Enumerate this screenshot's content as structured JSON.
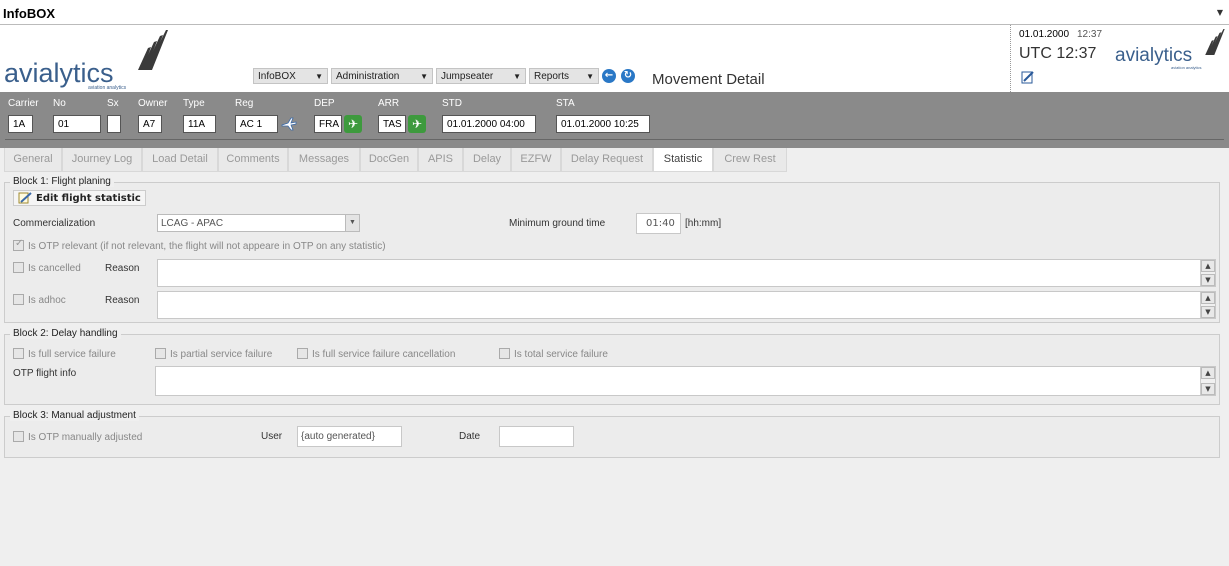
{
  "window": {
    "title": "InfoBOX",
    "menu_arrow": "▼"
  },
  "logo": {
    "name": "avialytics",
    "tagline": "aviation analytics"
  },
  "menus": [
    {
      "label": "InfoBOX"
    },
    {
      "label": "Administration"
    },
    {
      "label": "Jumpseater"
    },
    {
      "label": "Reports"
    }
  ],
  "page_title": "Movement Detail",
  "clock": {
    "date": "01.01.2000",
    "time": "12:37",
    "utc_label": "UTC 12:37"
  },
  "flight": {
    "labels": {
      "carrier": "Carrier",
      "no": "No",
      "sx": "Sx",
      "owner": "Owner",
      "type": "Type",
      "reg": "Reg",
      "dep": "DEP",
      "arr": "ARR",
      "std": "STD",
      "sta": "STA"
    },
    "values": {
      "carrier": "1A",
      "no": "01",
      "sx": "",
      "owner": "A7",
      "type": "11A",
      "reg": "AC 1",
      "dep": "FRA",
      "arr": "TAS",
      "std": "01.01.2000 04:00",
      "sta": "01.01.2000 10:25"
    }
  },
  "tabs": [
    {
      "label": "General"
    },
    {
      "label": "Journey Log"
    },
    {
      "label": "Load Detail"
    },
    {
      "label": "Comments"
    },
    {
      "label": "Messages"
    },
    {
      "label": "DocGen"
    },
    {
      "label": "APIS"
    },
    {
      "label": "Delay"
    },
    {
      "label": "EZFW"
    },
    {
      "label": "Delay Request"
    },
    {
      "label": "Statistic"
    },
    {
      "label": "Crew Rest"
    }
  ],
  "active_tab": "Statistic",
  "block1": {
    "title": "Block 1: Flight planing",
    "edit_button": "Edit flight statistic",
    "commercialization_label": "Commercialization",
    "commercialization_value": "LCAG - APAC",
    "min_ground_label": "Minimum ground time",
    "min_ground_value": "01:40",
    "min_ground_unit": "[hh:mm]",
    "otp_relevant_label": "Is OTP relevant (if not relevant, the flight will not appeare in OTP on any statistic)",
    "otp_relevant_checked": true,
    "cancelled_label": "Is cancelled",
    "adhoc_label": "Is adhoc",
    "reason_label": "Reason"
  },
  "block2": {
    "title": "Block 2: Delay handling",
    "full_failure": "Is full service failure",
    "partial_failure": "Is partial service failure",
    "full_failure_cancel": "Is full service failure cancellation",
    "total_failure": "Is total service failure",
    "otp_info_label": "OTP flight info"
  },
  "block3": {
    "title": "Block 3: Manual adjustment",
    "manual_label": "Is OTP manually adjusted",
    "user_label": "User",
    "user_value": "{auto generated}",
    "date_label": "Date",
    "date_value": ""
  },
  "colors": {
    "accent": "#3a5f8c",
    "flight_bar": "#8a8a8a",
    "plane_green": "#3d9a3d",
    "nav_blue": "#2a78c6"
  }
}
